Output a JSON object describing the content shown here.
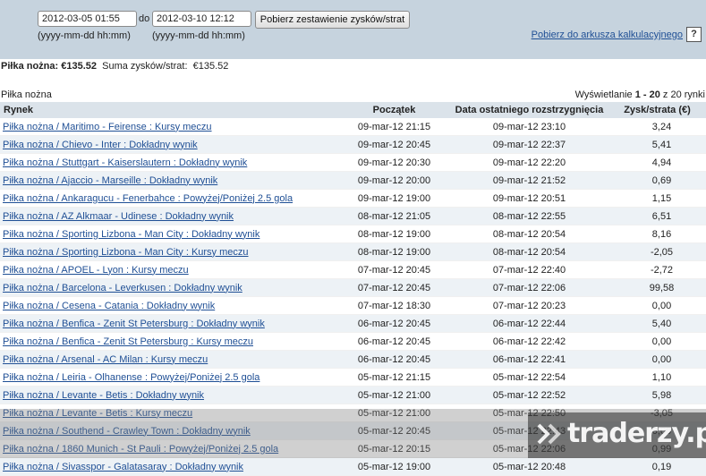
{
  "filter": {
    "from_value": "2012-03-05 01:55",
    "to_label": "do",
    "to_value": "2012-03-10 12:12",
    "format_hint_from": "(yyyy-mm-dd hh:mm)",
    "format_hint_to": "(yyyy-mm-dd hh:mm)",
    "submit_label": "Pobierz zestawienie zysków/strat",
    "sheet_link": "Pobierz do arkusza kalkulacyjnego",
    "help_icon": "?"
  },
  "summary": {
    "sport_label": "Piłka nożna:",
    "sport_total": "€135.52",
    "sum_label": "Suma zysków/strat:",
    "sum_total": "€135.52"
  },
  "section": {
    "title": "Piłka nożna",
    "paging_prefix": "Wyświetlanie",
    "paging_range": "1 - 20",
    "paging_suffix": "z 20 rynki"
  },
  "table": {
    "headers": [
      "Rynek",
      "Początek",
      "Data ostatniego rozstrzygnięcia",
      "Zysk/strata (€)"
    ],
    "rows": [
      {
        "market": "Piłka nożna / Maritimo - Feirense : Kursy meczu",
        "start": "09-mar-12 21:15",
        "settled": "09-mar-12 23:10",
        "pl": "3,24"
      },
      {
        "market": "Piłka nożna / Chievo - Inter : Dokładny wynik",
        "start": "09-mar-12 20:45",
        "settled": "09-mar-12 22:37",
        "pl": "5,41"
      },
      {
        "market": "Piłka nożna / Stuttgart - Kaiserslautern : Dokładny wynik",
        "start": "09-mar-12 20:30",
        "settled": "09-mar-12 22:20",
        "pl": "4,94"
      },
      {
        "market": "Piłka nożna / Ajaccio - Marseille : Dokładny wynik",
        "start": "09-mar-12 20:00",
        "settled": "09-mar-12 21:52",
        "pl": "0,69"
      },
      {
        "market": "Piłka nożna / Ankaragucu - Fenerbahce : Powyżej/Poniżej 2.5 gola",
        "start": "09-mar-12 19:00",
        "settled": "09-mar-12 20:51",
        "pl": "1,15"
      },
      {
        "market": "Piłka nożna / AZ Alkmaar - Udinese : Dokładny wynik",
        "start": "08-mar-12 21:05",
        "settled": "08-mar-12 22:55",
        "pl": "6,51"
      },
      {
        "market": "Piłka nożna / Sporting Lizbona - Man City : Dokładny wynik",
        "start": "08-mar-12 19:00",
        "settled": "08-mar-12 20:54",
        "pl": "8,16"
      },
      {
        "market": "Piłka nożna / Sporting Lizbona - Man City : Kursy meczu",
        "start": "08-mar-12 19:00",
        "settled": "08-mar-12 20:54",
        "pl": "-2,05"
      },
      {
        "market": "Piłka nożna / APOEL - Lyon : Kursy meczu",
        "start": "07-mar-12 20:45",
        "settled": "07-mar-12 22:40",
        "pl": "-2,72"
      },
      {
        "market": "Piłka nożna / Barcelona - Leverkusen : Dokładny wynik",
        "start": "07-mar-12 20:45",
        "settled": "07-mar-12 22:06",
        "pl": "99,58"
      },
      {
        "market": "Piłka nożna / Cesena - Catania : Dokładny wynik",
        "start": "07-mar-12 18:30",
        "settled": "07-mar-12 20:23",
        "pl": "0,00"
      },
      {
        "market": "Piłka nożna / Benfica - Zenit St Petersburg : Dokładny wynik",
        "start": "06-mar-12 20:45",
        "settled": "06-mar-12 22:44",
        "pl": "5,40"
      },
      {
        "market": "Piłka nożna / Benfica - Zenit St Petersburg : Kursy meczu",
        "start": "06-mar-12 20:45",
        "settled": "06-mar-12 22:42",
        "pl": "0,00"
      },
      {
        "market": "Piłka nożna / Arsenal - AC Milan : Kursy meczu",
        "start": "06-mar-12 20:45",
        "settled": "06-mar-12 22:41",
        "pl": "0,00"
      },
      {
        "market": "Piłka nożna / Leiria - Olhanense : Powyżej/Poniżej 2.5 gola",
        "start": "05-mar-12 21:15",
        "settled": "05-mar-12 22:54",
        "pl": "1,10"
      },
      {
        "market": "Piłka nożna / Levante - Betis : Dokładny wynik",
        "start": "05-mar-12 21:00",
        "settled": "05-mar-12 22:52",
        "pl": "5,98"
      },
      {
        "market": "Piłka nożna / Levante - Betis : Kursy meczu",
        "start": "05-mar-12 21:00",
        "settled": "05-mar-12 22:50",
        "pl": "-3,05"
      },
      {
        "market": "Piłka nożna / Southend - Crawley Town : Dokładny wynik",
        "start": "05-mar-12 20:45",
        "settled": "05-mar-12 22:43",
        "pl": "0,00"
      },
      {
        "market": "Piłka nożna / 1860 Munich - St Pauli : Powyżej/Poniżej 2.5 gola",
        "start": "05-mar-12 20:15",
        "settled": "05-mar-12 22:06",
        "pl": "0,99"
      },
      {
        "market": "Piłka nożna / Sivasspor - Galatasaray : Dokładny wynik",
        "start": "05-mar-12 19:00",
        "settled": "05-mar-12 20:48",
        "pl": "0,19"
      }
    ]
  },
  "watermark": {
    "text": "traderzy.pl",
    "icon": "traderzy-logo-icon"
  }
}
